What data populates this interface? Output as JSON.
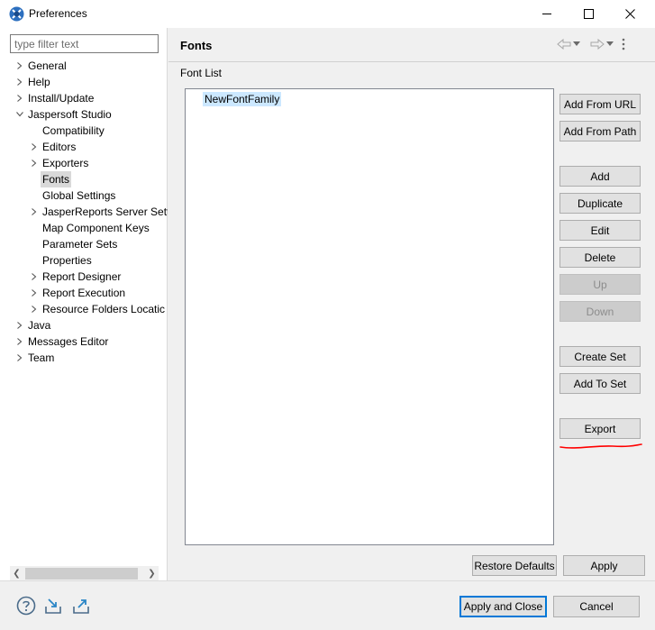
{
  "window": {
    "title": "Preferences",
    "controls": {
      "minimize": "minimize-icon",
      "maximize": "maximize-icon",
      "close": "close-icon"
    }
  },
  "filter": {
    "placeholder": "type filter text",
    "value": ""
  },
  "tree": [
    {
      "label": "General",
      "level": 0,
      "expander": "collapsed"
    },
    {
      "label": "Help",
      "level": 0,
      "expander": "collapsed"
    },
    {
      "label": "Install/Update",
      "level": 0,
      "expander": "collapsed"
    },
    {
      "label": "Jaspersoft Studio",
      "level": 0,
      "expander": "expanded"
    },
    {
      "label": "Compatibility",
      "level": 1,
      "expander": "none"
    },
    {
      "label": "Editors",
      "level": 1,
      "expander": "collapsed"
    },
    {
      "label": "Exporters",
      "level": 1,
      "expander": "collapsed"
    },
    {
      "label": "Fonts",
      "level": 1,
      "expander": "none",
      "selected": true
    },
    {
      "label": "Global Settings",
      "level": 1,
      "expander": "none"
    },
    {
      "label": "JasperReports Server Sett",
      "level": 1,
      "expander": "collapsed"
    },
    {
      "label": "Map Component Keys",
      "level": 1,
      "expander": "none"
    },
    {
      "label": "Parameter Sets",
      "level": 1,
      "expander": "none"
    },
    {
      "label": "Properties",
      "level": 1,
      "expander": "none"
    },
    {
      "label": "Report Designer",
      "level": 1,
      "expander": "collapsed"
    },
    {
      "label": "Report Execution",
      "level": 1,
      "expander": "collapsed"
    },
    {
      "label": "Resource Folders Locatic",
      "level": 1,
      "expander": "collapsed"
    },
    {
      "label": "Java",
      "level": 0,
      "expander": "collapsed"
    },
    {
      "label": "Messages Editor",
      "level": 0,
      "expander": "collapsed"
    },
    {
      "label": "Team",
      "level": 0,
      "expander": "collapsed"
    }
  ],
  "page": {
    "title": "Fonts",
    "nav": {
      "back": "back-arrow-icon",
      "back_menu": "dropdown-icon",
      "forward": "forward-arrow-icon",
      "forward_menu": "dropdown-icon",
      "menu": "view-menu-icon"
    },
    "font_list_label": "Font List",
    "fonts": [
      "NewFontFamily"
    ]
  },
  "buttons": {
    "add_from_url": "Add From URL",
    "add_from_path": "Add From Path",
    "add": "Add",
    "duplicate": "Duplicate",
    "edit": "Edit",
    "delete": "Delete",
    "up": "Up",
    "down": "Down",
    "create_set": "Create Set",
    "add_to_set": "Add To Set",
    "export": "Export",
    "restore_defaults": "Restore Defaults",
    "apply": "Apply",
    "apply_and_close": "Apply and Close",
    "cancel": "Cancel"
  },
  "footer_icons": [
    "help-icon",
    "import-icon",
    "export-icon"
  ],
  "colors": {
    "accent": "#0078d7",
    "selection": "#cce8ff",
    "annotation": "#ff0000"
  }
}
